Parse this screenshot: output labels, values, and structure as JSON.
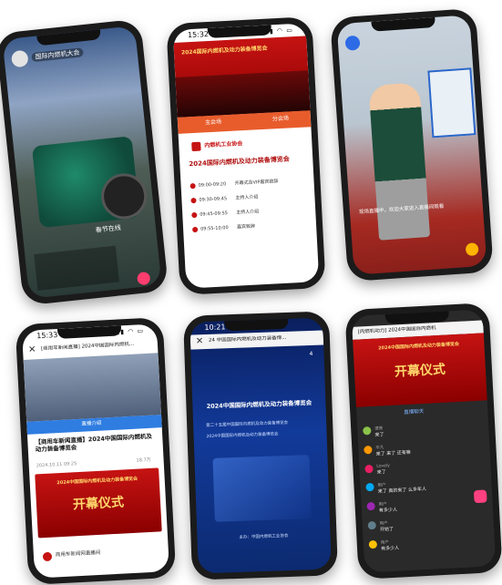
{
  "p1": {
    "live_tag": "国际内燃机大会",
    "sticker": "春节在线"
  },
  "p2": {
    "time": "15:32",
    "banner": "2024国际内燃机及动力装备博览会",
    "tab_left": "主会场",
    "tab_right": "分会场",
    "org": "内燃机工业协会",
    "expo_title": "2024国际内燃机及动力装备博览会",
    "schedule": [
      {
        "time": "09:00-09:20",
        "text": "开幕式及VIP嘉宾致辞"
      },
      {
        "time": "09:30-09:45",
        "text": "主持人介绍"
      },
      {
        "time": "09:45-09:55",
        "text": "主持人介绍"
      },
      {
        "time": "09:55-10:00",
        "text": "嘉宾致辞"
      }
    ]
  },
  "p3": {
    "caption": "现场直播中，欢迎大家进入直播间观看"
  },
  "p4": {
    "time": "15:33",
    "header": "[商用车新闻直播] 2024中国国际内燃机...",
    "tab": "直播介绍",
    "title": "【商用车新闻直播】2024中国国际内燃机及动力装备博览会",
    "date": "2024.10.11 09:25",
    "views": "18.7万",
    "banner_sub": "2024中国国际内燃机及动力装备博览会",
    "banner_main": "开幕仪式",
    "footer": "商用车新闻网直播间"
  },
  "p5": {
    "time": "10:21",
    "header": "24 中国国际内燃机及动力装备博...",
    "title": "2024中国国际内燃机及动力装备博览会",
    "line1": "第二十五届中国国际内燃机及动力装备博览会",
    "line2": "2024中国国际内燃机及动力装备博览会",
    "footer": "主办：中国内燃机工业协会",
    "counter": "4"
  },
  "p6": {
    "header": "[内燃机动力] 2024中国国际内燃机",
    "banner_sub": "2024中国国际内燃机及动力装备博览会",
    "banner_main": "开幕仪式",
    "tab": "直播聊天",
    "comments": [
      {
        "name": "漂亮",
        "text": "来了"
      },
      {
        "name": "平凡",
        "text": "来了 来了 还有嘛"
      },
      {
        "name": "Lovely",
        "text": "来了"
      },
      {
        "name": "用户",
        "text": "来了 真的来了 么多年人"
      },
      {
        "name": "用户",
        "text": "有多少人"
      },
      {
        "name": "用户",
        "text": "开始了"
      },
      {
        "name": "用户",
        "text": "有多少人"
      }
    ]
  },
  "colors": {
    "red": "#c61313",
    "gold": "#ffd66b",
    "navy": "#0d2a73",
    "dark": "#2a2a2a"
  }
}
